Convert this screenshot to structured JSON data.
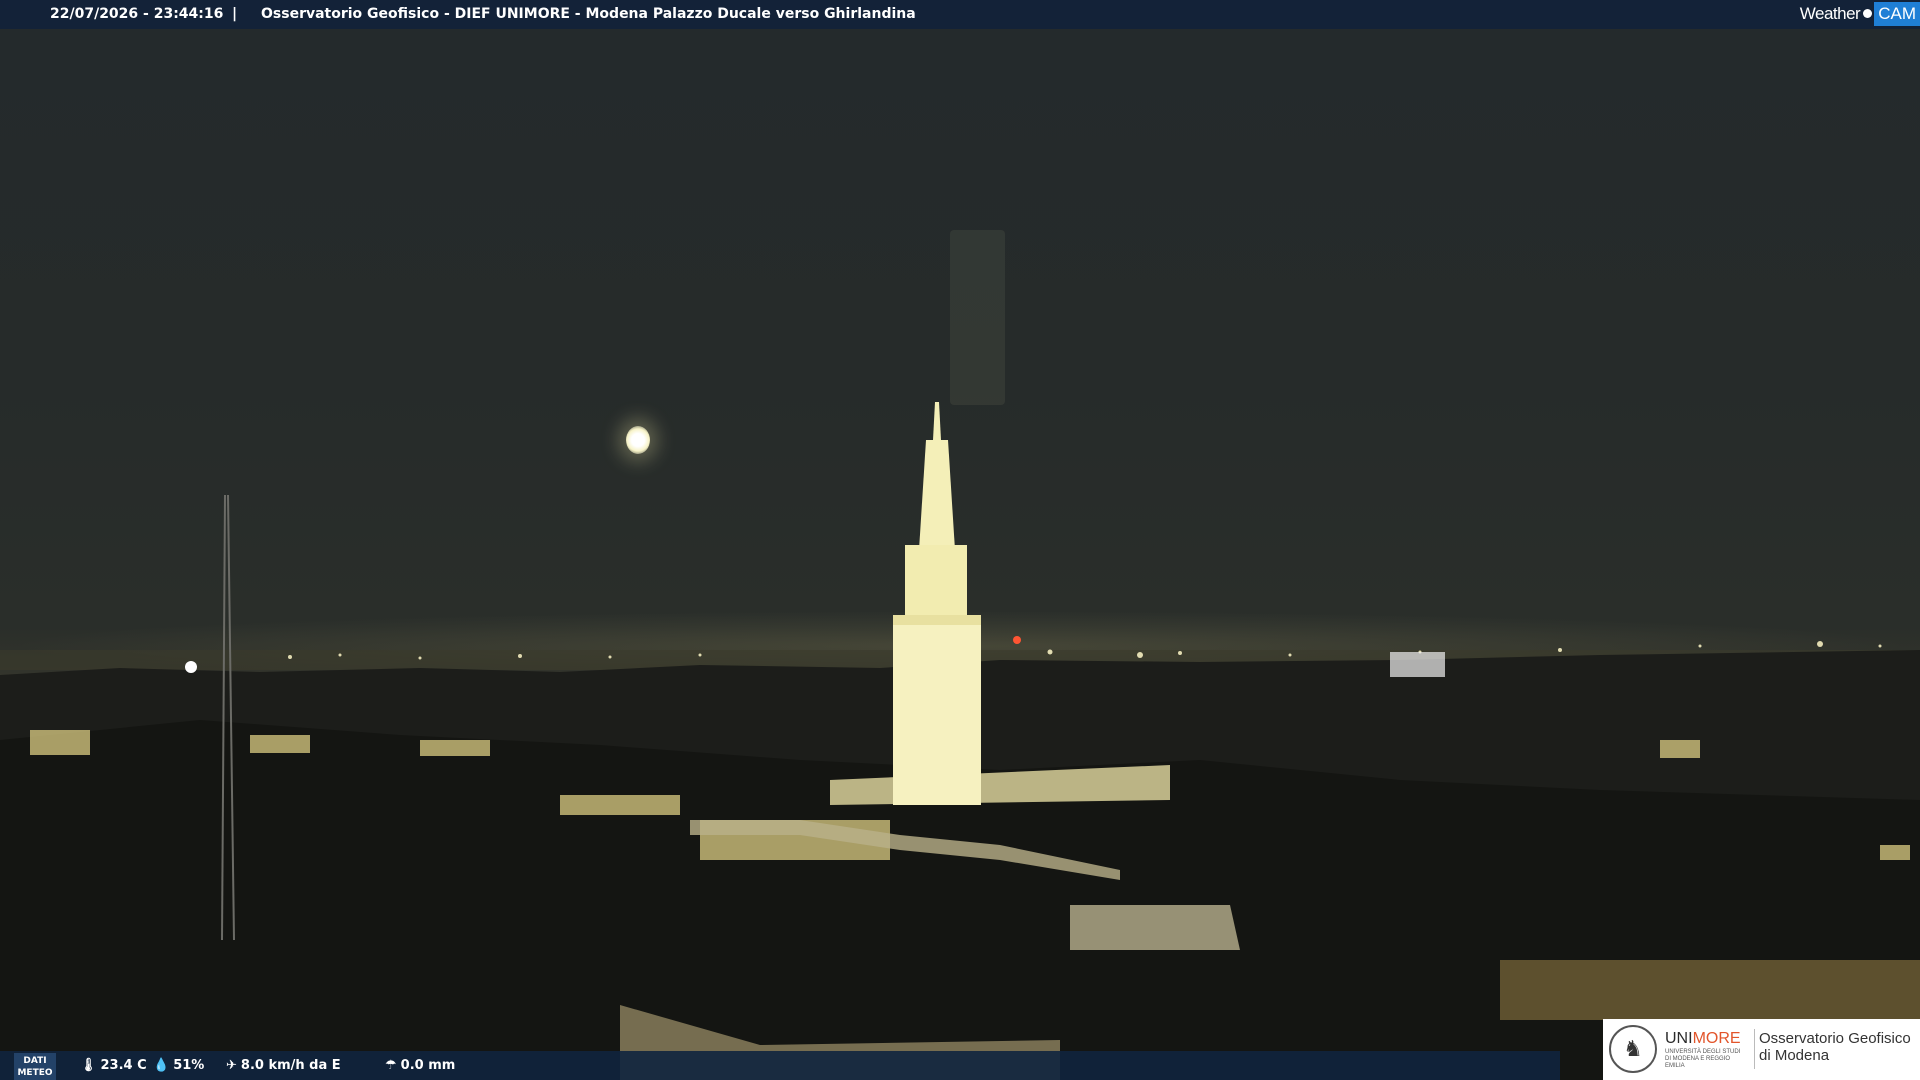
{
  "overlay": {
    "timestamp": "22/07/2026 - 23:44:16",
    "separator": "|",
    "caption": "Osservatorio Geofisico - DIEF UNIMORE - Modena Palazzo Ducale verso Ghirlandina",
    "brand_weather": "Weather",
    "brand_cam": "CAM"
  },
  "weather": {
    "label_line1": "DATI",
    "label_line2": "METEO",
    "temperature": "23.4 C",
    "humidity": "51%",
    "wind": "8.0 km/h da E",
    "rain": "0.0 mm",
    "temperature_icon": "thermometer-icon",
    "humidity_icon": "droplet-icon",
    "wind_icon": "wind-icon",
    "rain_icon": "rain-gauge-icon"
  },
  "logo": {
    "uni": "UNI",
    "more": "MORE",
    "small_text": "UNIVERSITÀ DEGLI STUDI DI MODENA E REGGIO EMILIA",
    "observatory_line1": "Osservatorio Geofisico",
    "observatory_line2": "di Modena"
  },
  "colors": {
    "topbar": "#12223a",
    "brand_accent": "#1f7fd6",
    "unimore_accent": "#e2552b",
    "tower_light": "#f4efb8"
  }
}
